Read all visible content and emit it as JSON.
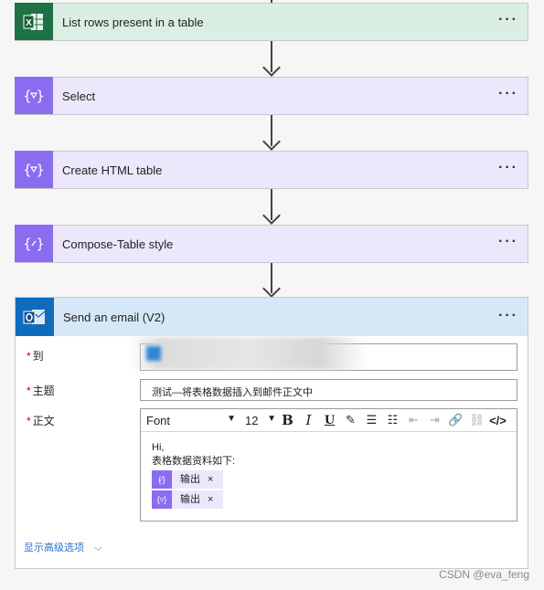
{
  "steps": [
    {
      "title": "List rows present in a table",
      "icon": "excel-icon"
    },
    {
      "title": "Select",
      "icon": "data-operation-icon"
    },
    {
      "title": "Create HTML table",
      "icon": "data-operation-icon"
    },
    {
      "title": "Compose-Table style",
      "icon": "compose-icon"
    }
  ],
  "more_label": "···",
  "email": {
    "title": "Send an email (V2)",
    "required_mark": "*",
    "to_label": "到",
    "subject_label": "主题",
    "subject_value": "测试—将表格数据插入到邮件正文中",
    "body_label": "正文",
    "toolbar": {
      "font": "Font",
      "size": "12"
    },
    "body_line1": "Hi,",
    "body_line2": "表格数据资料如下:",
    "token1": "输出",
    "token2": "输出",
    "remove": "×",
    "advanced": "显示高级选项"
  },
  "watermark": "CSDN @eva_feng",
  "colors": {
    "excel": "#1e7145",
    "data_operation": "#8a6cf0",
    "outlook": "#0f6cbd"
  }
}
